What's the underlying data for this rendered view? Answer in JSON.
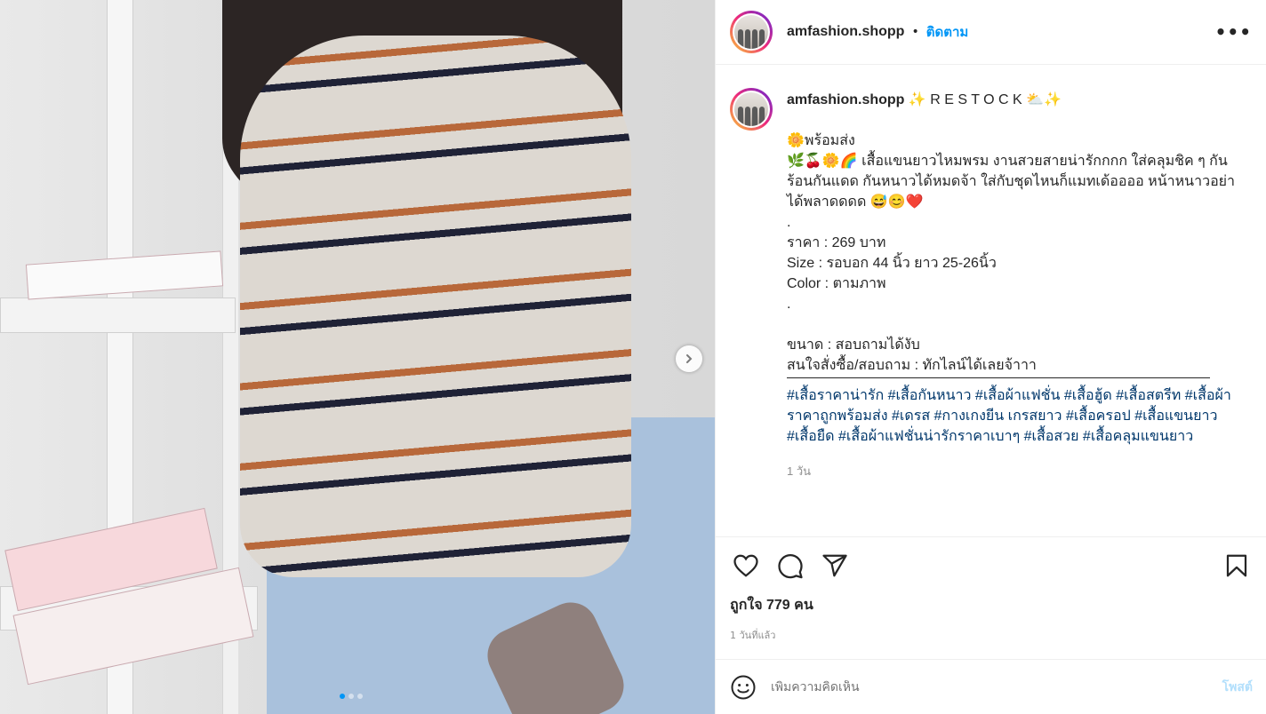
{
  "post": {
    "username": "amfashion.shopp",
    "follow_label": "ติดตาม",
    "dot": "•",
    "more_label": "•••"
  },
  "caption": {
    "username": "amfashion.shopp",
    "headline": " ✨ R E S T O C K ⛅✨",
    "lines": [
      "🌼พร้อมส่ง",
      "🌿🍒🌼🌈 เสื้อแขนยาวไหมพรม งานสวยสายน่ารักกกก ใส่คลุมชิค ๆ กันร้อนกันแดด กันหนาวได้หมดจ้า ใส่กับชุดไหนก็แมทเด้ออออ หน้าหนาวอย่าได้พลาดดดด 😅😊❤️",
      ".",
      "ราคา : 269 บาท",
      "Size : รอบอก 44 นิ้ว ยาว 25-26นิ้ว",
      "Color : ตามภาพ",
      ".",
      "",
      "ขนาด : สอบถามได้งับ",
      "สนใจสั่งซื้อ/สอบถาม : ทักไลน์ได้เลยจ้าาา"
    ],
    "hashtags": "#เสื้อราคาน่ารัก #เสื้อกันหนาว #เสื้อผ้าแฟชั่น #เสื้อฮู้ด #เสื้อสตรีท #เสื้อผ้าราคาถูกพร้อมส่ง #เดรส #กางเกงยีน เกรสยาว #เสื้อครอป #เสื้อแขนยาว #เสื้อยืด #เสื้อผ้าแฟชั่นน่ารักราคาเบาๆ #เสื้อสวย #เสื้อคลุมแขนยาว",
    "time": "1 วัน"
  },
  "actions": {
    "likes": "ถูกใจ 779 คน",
    "time_ago": "1 วันที่แล้ว"
  },
  "comment": {
    "placeholder": "เพิ่มความคิดเห็น",
    "post_label": "โพสต์"
  },
  "carousel": {
    "slides": 3,
    "active_slide": 1
  },
  "colors": {
    "accent_blue": "#0095f6",
    "post_disabled": "#b2dffc",
    "hashtag": "#00376b"
  },
  "icons": [
    "heart-icon",
    "comment-icon",
    "share-icon",
    "bookmark-icon",
    "emoji-icon",
    "chevron-right-icon",
    "more-icon"
  ]
}
